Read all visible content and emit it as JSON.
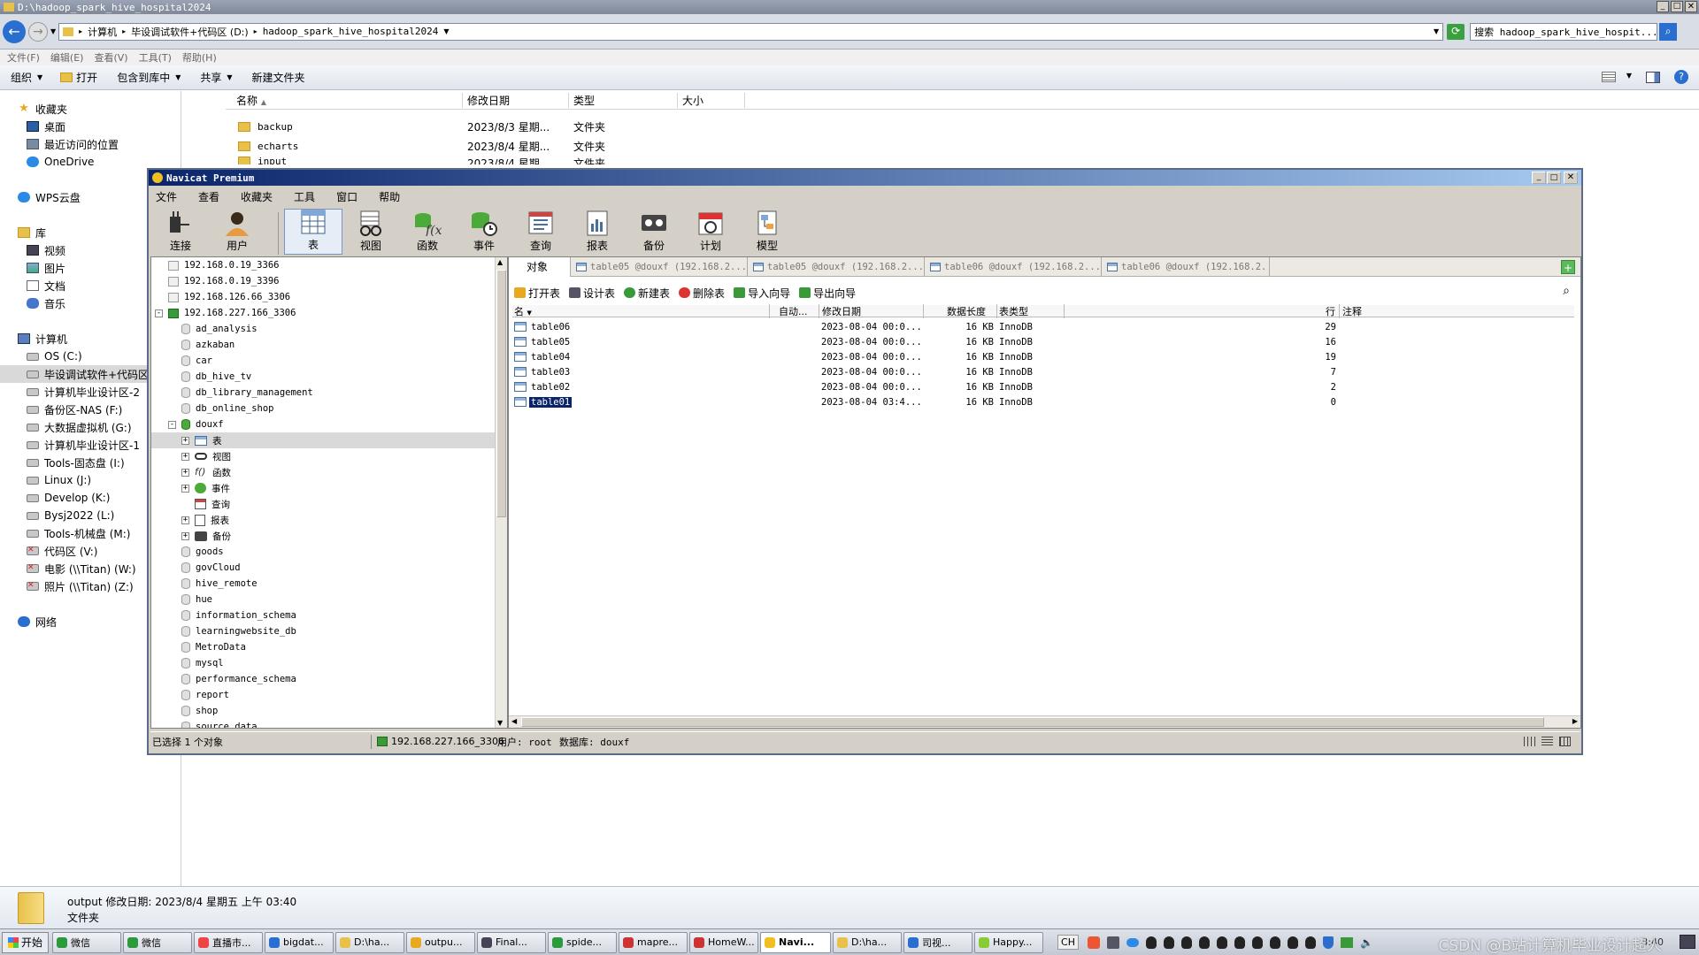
{
  "explorer": {
    "title": "D:\\hadoop_spark_hive_hospital2024",
    "crumbs": [
      "计算机",
      "毕设调试软件+代码区 (D:)",
      "hadoop_spark_hive_hospital2024"
    ],
    "search": "搜索 hadoop_spark_hive_hospit...",
    "menu": [
      "文件(F)",
      "编辑(E)",
      "查看(V)",
      "工具(T)",
      "帮助(H)"
    ],
    "toolbar": [
      "组织",
      "打开",
      "包含到库中",
      "共享",
      "新建文件夹"
    ],
    "columns": [
      "名称",
      "修改日期",
      "类型",
      "大小"
    ],
    "files": [
      {
        "name": "backup",
        "date": "2023/8/3 星期...",
        "type": "文件夹"
      },
      {
        "name": "echarts",
        "date": "2023/8/4 星期...",
        "type": "文件夹"
      },
      {
        "name": "input",
        "date": "2023/8/4 星期...",
        "type": "文件夹"
      }
    ],
    "nav": [
      {
        "label": "收藏夹",
        "icon": "star-icon",
        "indent": 0
      },
      {
        "label": "桌面",
        "icon": "desktop-icon",
        "indent": 1
      },
      {
        "label": "最近访问的位置",
        "icon": "recent-icon",
        "indent": 1
      },
      {
        "label": "OneDrive",
        "icon": "cloud-icon",
        "indent": 1
      },
      {
        "label": "",
        "icon": "",
        "indent": 0
      },
      {
        "label": "WPS云盘",
        "icon": "cloud-icon",
        "indent": 0
      },
      {
        "label": "",
        "icon": "",
        "indent": 0
      },
      {
        "label": "库",
        "icon": "library-icon",
        "indent": 0
      },
      {
        "label": "视频",
        "icon": "video-icon",
        "indent": 1
      },
      {
        "label": "图片",
        "icon": "picture-icon",
        "indent": 1
      },
      {
        "label": "文档",
        "icon": "document-icon",
        "indent": 1
      },
      {
        "label": "音乐",
        "icon": "music-icon",
        "indent": 1
      },
      {
        "label": "",
        "icon": "",
        "indent": 0
      },
      {
        "label": "计算机",
        "icon": "computer-icon",
        "indent": 0
      },
      {
        "label": "OS (C:)",
        "icon": "drive-icon",
        "indent": 1
      },
      {
        "label": "毕设调试软件+代码区",
        "icon": "drive-icon",
        "indent": 1,
        "selected": true
      },
      {
        "label": "计算机毕业设计区-2",
        "icon": "drive-icon",
        "indent": 1
      },
      {
        "label": "备份区-NAS (F:)",
        "icon": "drive-icon",
        "indent": 1
      },
      {
        "label": "大数据虚拟机 (G:)",
        "icon": "drive-icon",
        "indent": 1
      },
      {
        "label": "计算机毕业设计区-1",
        "icon": "drive-icon",
        "indent": 1
      },
      {
        "label": "Tools-固态盘 (I:)",
        "icon": "drive-icon",
        "indent": 1
      },
      {
        "label": "Linux (J:)",
        "icon": "drive-icon",
        "indent": 1
      },
      {
        "label": "Develop (K:)",
        "icon": "drive-icon",
        "indent": 1
      },
      {
        "label": "Bysj2022 (L:)",
        "icon": "drive-icon",
        "indent": 1
      },
      {
        "label": "Tools-机械盘 (M:)",
        "icon": "drive-icon",
        "indent": 1
      },
      {
        "label": "代码区 (V:)",
        "icon": "network-drive-icon",
        "indent": 1
      },
      {
        "label": "电影 (\\\\Titan) (W:)",
        "icon": "network-drive-icon",
        "indent": 1
      },
      {
        "label": "照片 (\\\\Titan) (Z:)",
        "icon": "network-drive-icon",
        "indent": 1
      },
      {
        "label": "",
        "icon": "",
        "indent": 0
      },
      {
        "label": "网络",
        "icon": "network-icon",
        "indent": 0
      }
    ],
    "details": {
      "line1": "output  修改日期: 2023/8/4 星期五 上午 03:40",
      "line2": "文件夹"
    }
  },
  "navicat": {
    "title": "Navicat Premium",
    "menu": [
      "文件",
      "查看",
      "收藏夹",
      "工具",
      "窗口",
      "帮助"
    ],
    "tools": [
      {
        "label": "连接",
        "icon": "plug-icon"
      },
      {
        "label": "用户",
        "icon": "user-icon"
      },
      {
        "label": "表",
        "icon": "table-icon",
        "active": true
      },
      {
        "label": "视图",
        "icon": "view-icon"
      },
      {
        "label": "函数",
        "icon": "function-icon"
      },
      {
        "label": "事件",
        "icon": "event-icon"
      },
      {
        "label": "查询",
        "icon": "query-icon"
      },
      {
        "label": "报表",
        "icon": "report-icon"
      },
      {
        "label": "备份",
        "icon": "backup-icon"
      },
      {
        "label": "计划",
        "icon": "schedule-icon"
      },
      {
        "label": "模型",
        "icon": "model-icon"
      }
    ],
    "tree": [
      {
        "t": "192.168.0.19_3366",
        "lvl": 0,
        "ic": "conn"
      },
      {
        "t": "192.168.0.19_3396",
        "lvl": 0,
        "ic": "conn"
      },
      {
        "t": "192.168.126.66_3306",
        "lvl": 0,
        "ic": "conn"
      },
      {
        "t": "192.168.227.166_3306",
        "lvl": 0,
        "ic": "conn-on",
        "exp": "-"
      },
      {
        "t": "ad_analysis",
        "lvl": 1,
        "ic": "db"
      },
      {
        "t": "azkaban",
        "lvl": 1,
        "ic": "db"
      },
      {
        "t": "car",
        "lvl": 1,
        "ic": "db"
      },
      {
        "t": "db_hive_tv",
        "lvl": 1,
        "ic": "db"
      },
      {
        "t": "db_library_management",
        "lvl": 1,
        "ic": "db"
      },
      {
        "t": "db_online_shop",
        "lvl": 1,
        "ic": "db"
      },
      {
        "t": "douxf",
        "lvl": 1,
        "ic": "db-on",
        "exp": "-"
      },
      {
        "t": "表",
        "lvl": 2,
        "ic": "table",
        "exp": "+",
        "sel": true
      },
      {
        "t": "视图",
        "lvl": 2,
        "ic": "view",
        "exp": "+"
      },
      {
        "t": "函数",
        "lvl": 2,
        "ic": "func",
        "exp": "+"
      },
      {
        "t": "事件",
        "lvl": 2,
        "ic": "event",
        "exp": "+"
      },
      {
        "t": "查询",
        "lvl": 2,
        "ic": "query"
      },
      {
        "t": "报表",
        "lvl": 2,
        "ic": "report",
        "exp": "+"
      },
      {
        "t": "备份",
        "lvl": 2,
        "ic": "backup",
        "exp": "+"
      },
      {
        "t": "goods",
        "lvl": 1,
        "ic": "db"
      },
      {
        "t": "govCloud",
        "lvl": 1,
        "ic": "db"
      },
      {
        "t": "hive_remote",
        "lvl": 1,
        "ic": "db"
      },
      {
        "t": "hue",
        "lvl": 1,
        "ic": "db"
      },
      {
        "t": "information_schema",
        "lvl": 1,
        "ic": "db"
      },
      {
        "t": "learningwebsite_db",
        "lvl": 1,
        "ic": "db"
      },
      {
        "t": "MetroData",
        "lvl": 1,
        "ic": "db"
      },
      {
        "t": "mysql",
        "lvl": 1,
        "ic": "db"
      },
      {
        "t": "performance_schema",
        "lvl": 1,
        "ic": "db"
      },
      {
        "t": "report",
        "lvl": 1,
        "ic": "db"
      },
      {
        "t": "shop",
        "lvl": 1,
        "ic": "db"
      },
      {
        "t": "source_data",
        "lvl": 1,
        "ic": "db"
      }
    ],
    "tabs": [
      "对象",
      "table05 @douxf (192.168.2...",
      "table05 @douxf (192.168.2...",
      "table06 @douxf (192.168.2...",
      "table06 @douxf (192.168.2..."
    ],
    "actions": [
      "打开表",
      "设计表",
      "新建表",
      "删除表",
      "导入向导",
      "导出向导"
    ],
    "columns": [
      "名",
      "自动...",
      "修改日期",
      "数据长度",
      "表类型",
      "行",
      "注释"
    ],
    "rows": [
      {
        "name": "table06",
        "date": "2023-08-04 00:0...",
        "size": "16 KB",
        "engine": "InnoDB",
        "rows": "29"
      },
      {
        "name": "table05",
        "date": "2023-08-04 00:0...",
        "size": "16 KB",
        "engine": "InnoDB",
        "rows": "16"
      },
      {
        "name": "table04",
        "date": "2023-08-04 00:0...",
        "size": "16 KB",
        "engine": "InnoDB",
        "rows": "19"
      },
      {
        "name": "table03",
        "date": "2023-08-04 00:0...",
        "size": "16 KB",
        "engine": "InnoDB",
        "rows": "7"
      },
      {
        "name": "table02",
        "date": "2023-08-04 00:0...",
        "size": "16 KB",
        "engine": "InnoDB",
        "rows": "2"
      },
      {
        "name": "table01",
        "date": "2023-08-04 03:4...",
        "size": "16 KB",
        "engine": "InnoDB",
        "rows": "0",
        "selected": true
      }
    ],
    "status": {
      "selected": "已选择 1 个对象",
      "conn": "192.168.227.166_3306",
      "user": "用户: root",
      "db": "数据库: douxf"
    }
  },
  "taskbar": {
    "start": "开始",
    "items": [
      "微信",
      "微信",
      "直播市...",
      "bigdat...",
      "D:\\ha...",
      "outpu...",
      "Final...",
      "spide...",
      "mapre...",
      "HomeW...",
      "Navi...",
      "D:\\ha...",
      "司视...",
      "Happy..."
    ],
    "lang": "CH",
    "time": "3:40",
    "watermark": "CSDN @B站计算机毕业设计超人"
  },
  "colors": {
    "titlebar": "#0a246a",
    "selection": "#0a246a",
    "accent": "#316ac5"
  }
}
